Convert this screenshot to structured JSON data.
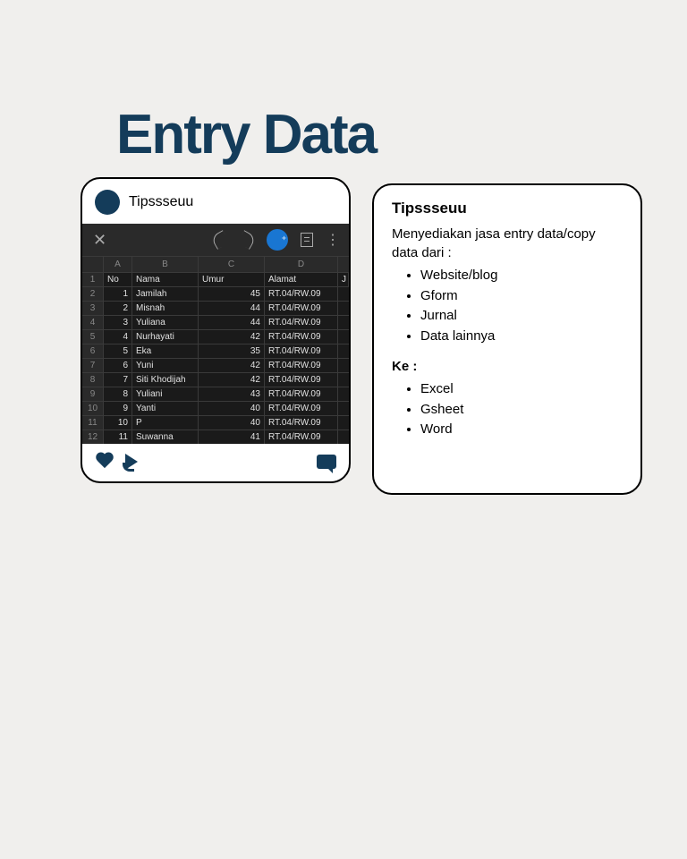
{
  "title": "Entry Data",
  "left_card": {
    "username": "Tipssseuu",
    "columns": [
      "A",
      "B",
      "C",
      "D"
    ],
    "header_row": {
      "no_label": "No",
      "nama_label": "Nama",
      "umur_label": "Umur",
      "alamat_label": "Alamat",
      "j_label": "J"
    },
    "rows": [
      {
        "rnum": "1"
      },
      {
        "rnum": "2",
        "no": "1",
        "nama": "Jamilah",
        "umur": "45",
        "alamat": "RT.04/RW.09"
      },
      {
        "rnum": "3",
        "no": "2",
        "nama": "Misnah",
        "umur": "44",
        "alamat": "RT.04/RW.09"
      },
      {
        "rnum": "4",
        "no": "3",
        "nama": "Yuliana",
        "umur": "44",
        "alamat": "RT.04/RW.09"
      },
      {
        "rnum": "5",
        "no": "4",
        "nama": "Nurhayati",
        "umur": "42",
        "alamat": "RT.04/RW.09"
      },
      {
        "rnum": "6",
        "no": "5",
        "nama": "Eka",
        "umur": "35",
        "alamat": "RT.04/RW.09"
      },
      {
        "rnum": "7",
        "no": "6",
        "nama": "Yuni",
        "umur": "42",
        "alamat": "RT.04/RW.09"
      },
      {
        "rnum": "8",
        "no": "7",
        "nama": "Siti Khodijah",
        "umur": "42",
        "alamat": "RT.04/RW.09"
      },
      {
        "rnum": "9",
        "no": "8",
        "nama": "Yuliani",
        "umur": "43",
        "alamat": "RT.04/RW.09"
      },
      {
        "rnum": "10",
        "no": "9",
        "nama": "Yanti",
        "umur": "40",
        "alamat": "RT.04/RW.09"
      },
      {
        "rnum": "11",
        "no": "10",
        "nama": "P",
        "umur": "40",
        "alamat": "RT.04/RW.09"
      },
      {
        "rnum": "12",
        "no": "11",
        "nama": "Suwanna",
        "umur": "41",
        "alamat": "RT.04/RW.09"
      }
    ]
  },
  "right_card": {
    "username": "Tipssseuu",
    "description": "Menyediakan jasa entry data/copy data dari :",
    "from_items": [
      "Website/blog",
      "Gform",
      "Jurnal",
      "Data lainnya"
    ],
    "ke_label": "Ke :",
    "to_items": [
      "Excel",
      "Gsheet",
      "Word"
    ]
  }
}
